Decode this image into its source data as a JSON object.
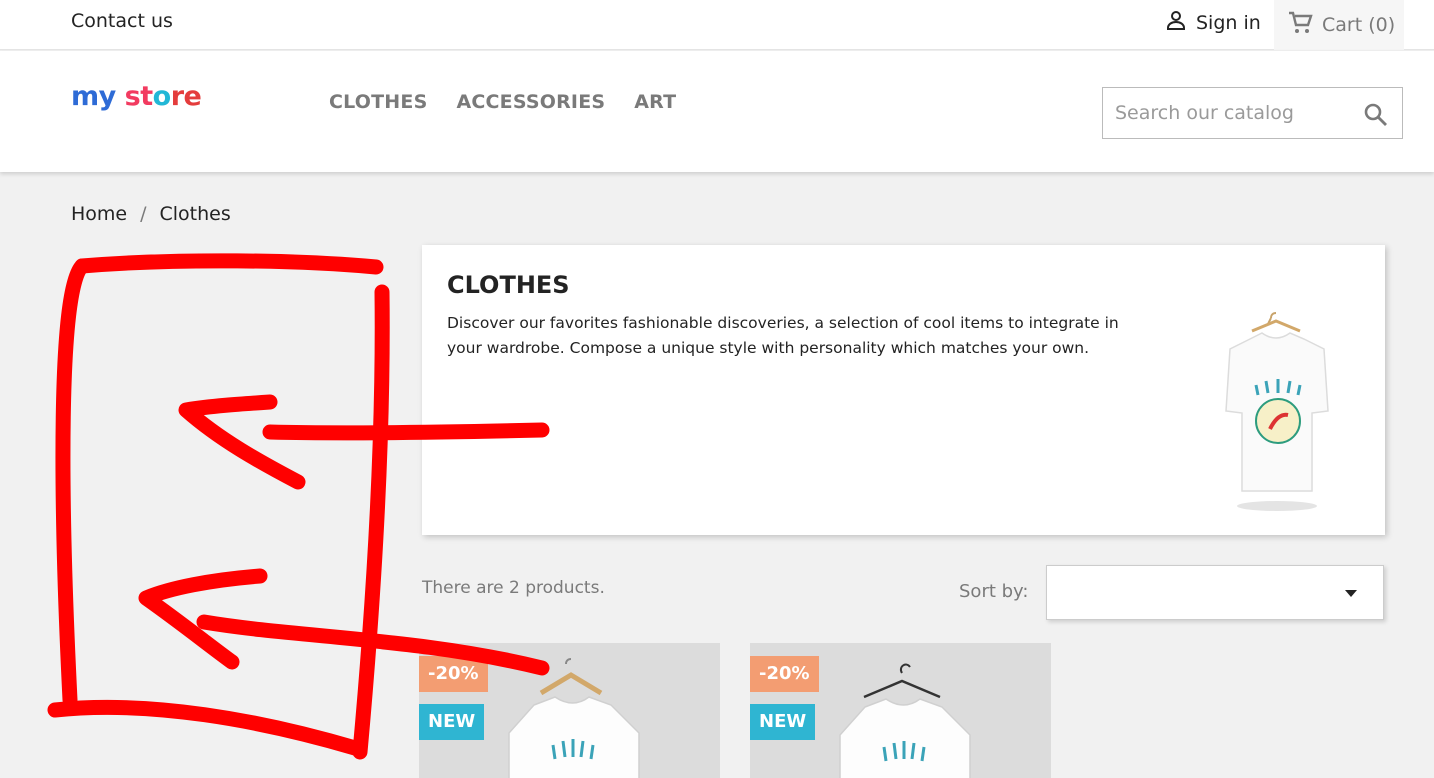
{
  "topbar": {
    "contact": "Contact us",
    "signin": "Sign in",
    "cart": "Cart (0)"
  },
  "header": {
    "logo_parts": [
      "my",
      " st",
      "o",
      "re"
    ],
    "nav": [
      "CLOTHES",
      "ACCESSORIES",
      "ART"
    ],
    "search_placeholder": "Search our catalog"
  },
  "breadcrumb": [
    "Home",
    "/",
    "Clothes"
  ],
  "category": {
    "title": "CLOTHES",
    "description": "Discover our favorites fashionable discoveries, a selection of cool items to integrate in your wardrobe. Compose a unique style with personality which matches your own."
  },
  "listing": {
    "count": "There are 2 products.",
    "sort_label": "Sort by:",
    "sort_value": ""
  },
  "products": [
    {
      "discount": "-20%",
      "badge": "NEW"
    },
    {
      "discount": "-20%",
      "badge": "NEW"
    }
  ],
  "colors": {
    "annotation": "#ff0000",
    "new_badge": "#2fb5d2",
    "discount_badge": "#f39d72"
  },
  "icons": [
    "person-icon",
    "cart-icon",
    "search-icon",
    "caret-down-icon"
  ]
}
